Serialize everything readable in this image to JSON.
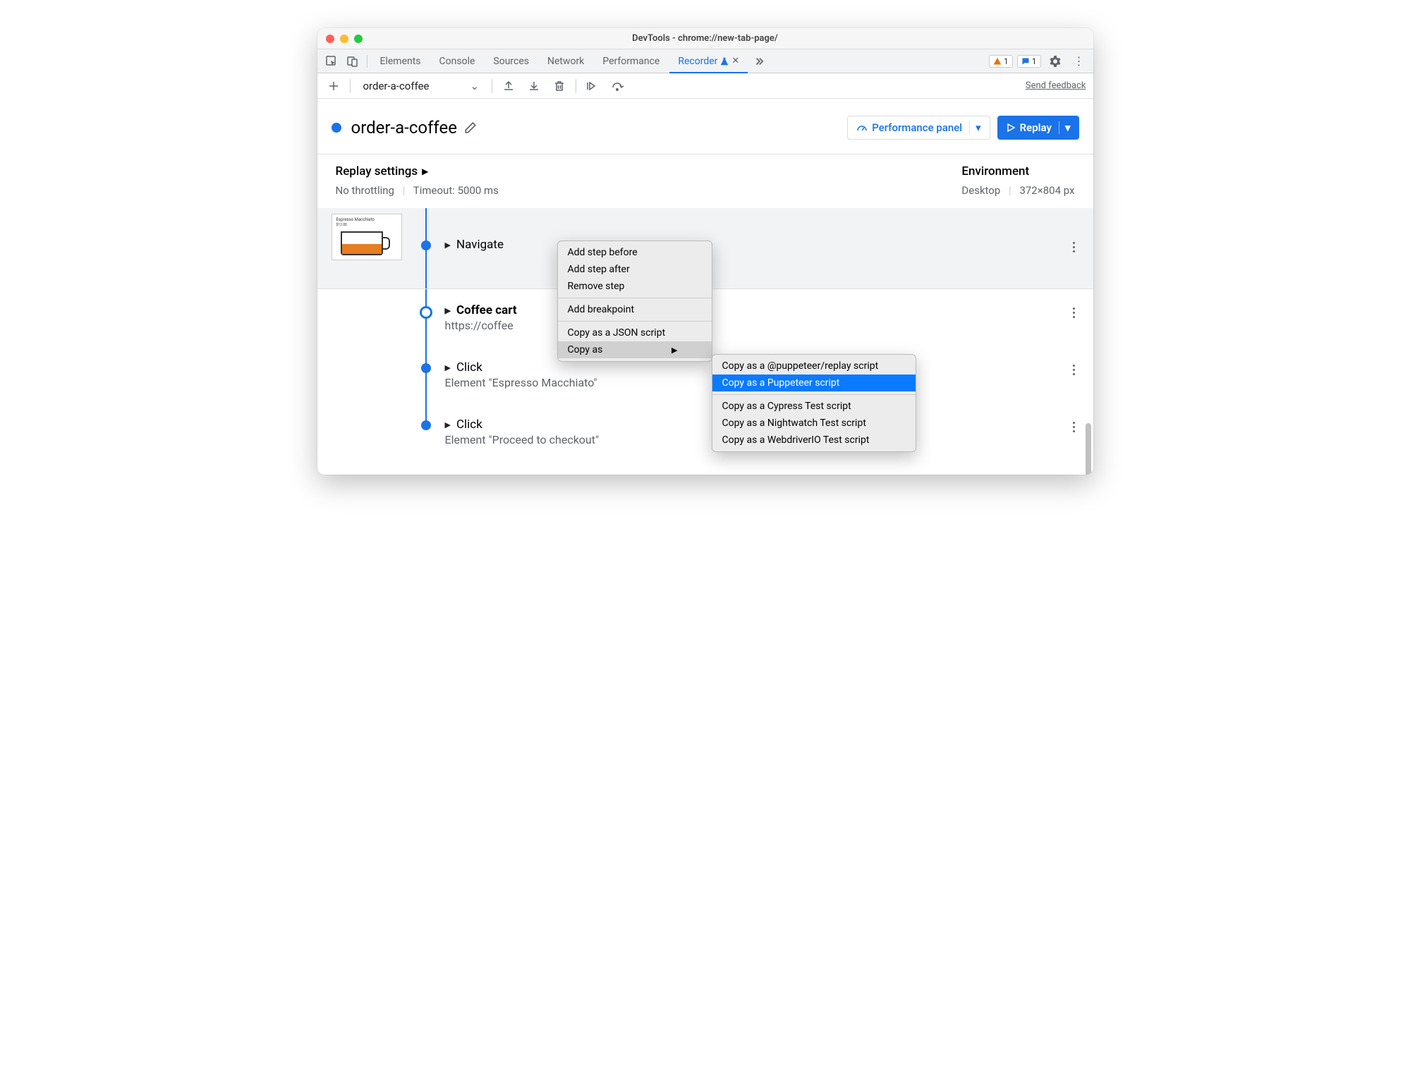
{
  "window_title": "DevTools - chrome://new-tab-page/",
  "tabs": {
    "elements": "Elements",
    "console": "Console",
    "sources": "Sources",
    "network": "Network",
    "performance": "Performance",
    "recorder": "Recorder"
  },
  "badge_warn": "1",
  "badge_info": "1",
  "toolbar": {
    "recording_name": "order-a-coffee",
    "send_feedback": "Send feedback"
  },
  "header": {
    "title": "order-a-coffee",
    "perf_panel": "Performance panel",
    "replay": "Replay"
  },
  "settings": {
    "replay_settings": "Replay settings",
    "no_throttling": "No throttling",
    "timeout": "Timeout: 5000 ms",
    "environment": "Environment",
    "device": "Desktop",
    "dimensions": "372×804 px"
  },
  "thumbnail": {
    "title": "Espresso Macchiato",
    "price": "$12.00"
  },
  "steps": {
    "navigate": "Navigate",
    "coffee_cart": "Coffee cart",
    "coffee_url": "https://coffee",
    "click1": "Click",
    "click1_sub": "Element \"Espresso Macchiato\"",
    "click2": "Click",
    "click2_sub": "Element \"Proceed to checkout\""
  },
  "menu1": {
    "add_before": "Add step before",
    "add_after": "Add step after",
    "remove": "Remove step",
    "breakpoint": "Add breakpoint",
    "copy_json": "Copy as a JSON script",
    "copy_as": "Copy as"
  },
  "menu2": {
    "puppeteer_replay": "Copy as a @puppeteer/replay script",
    "puppeteer": "Copy as a Puppeteer script",
    "cypress": "Copy as a Cypress Test script",
    "nightwatch": "Copy as a Nightwatch Test script",
    "webdriverio": "Copy as a WebdriverIO Test script"
  }
}
